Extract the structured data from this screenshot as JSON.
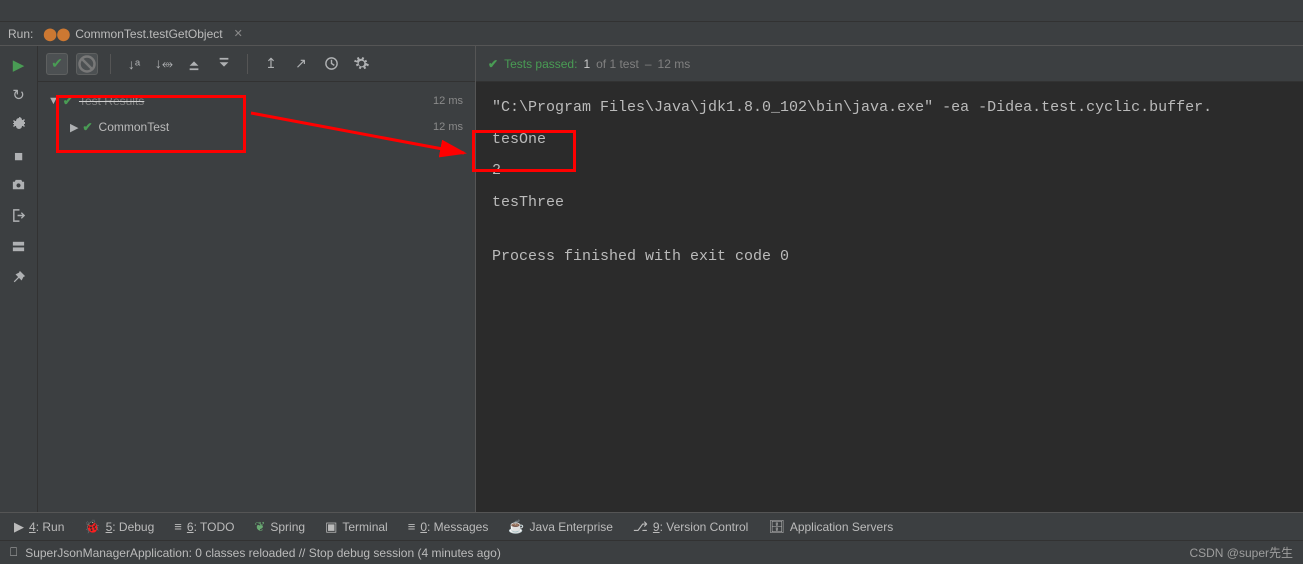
{
  "header": {
    "run_label": "Run:",
    "tab_title": "CommonTest.testGetObject"
  },
  "tree": {
    "root_label": "Test Results",
    "root_time": "12 ms",
    "child_label": "CommonTest",
    "child_time": "12 ms"
  },
  "passbar": {
    "prefix": "Tests passed:",
    "count": "1",
    "of": "of 1 test",
    "dash": "–",
    "time": "12 ms"
  },
  "console": {
    "cmd": "\"C:\\Program Files\\Java\\jdk1.8.0_102\\bin\\java.exe\" -ea -Didea.test.cyclic.buffer.",
    "line1": "tesOne",
    "line2": "2",
    "line3": "tesThree",
    "exit": "Process finished with exit code 0"
  },
  "bottombar": {
    "run": "4: Run",
    "debug": "5: Debug",
    "todo": "6: TODO",
    "spring": "Spring",
    "terminal": "Terminal",
    "messages": "0: Messages",
    "javaee": "Java Enterprise",
    "vcs": "9: Version Control",
    "appservers": "Application Servers"
  },
  "status": {
    "message": "SuperJsonManagerApplication: 0 classes reloaded // Stop debug session (4 minutes ago)",
    "watermark": "CSDN @super先生"
  }
}
